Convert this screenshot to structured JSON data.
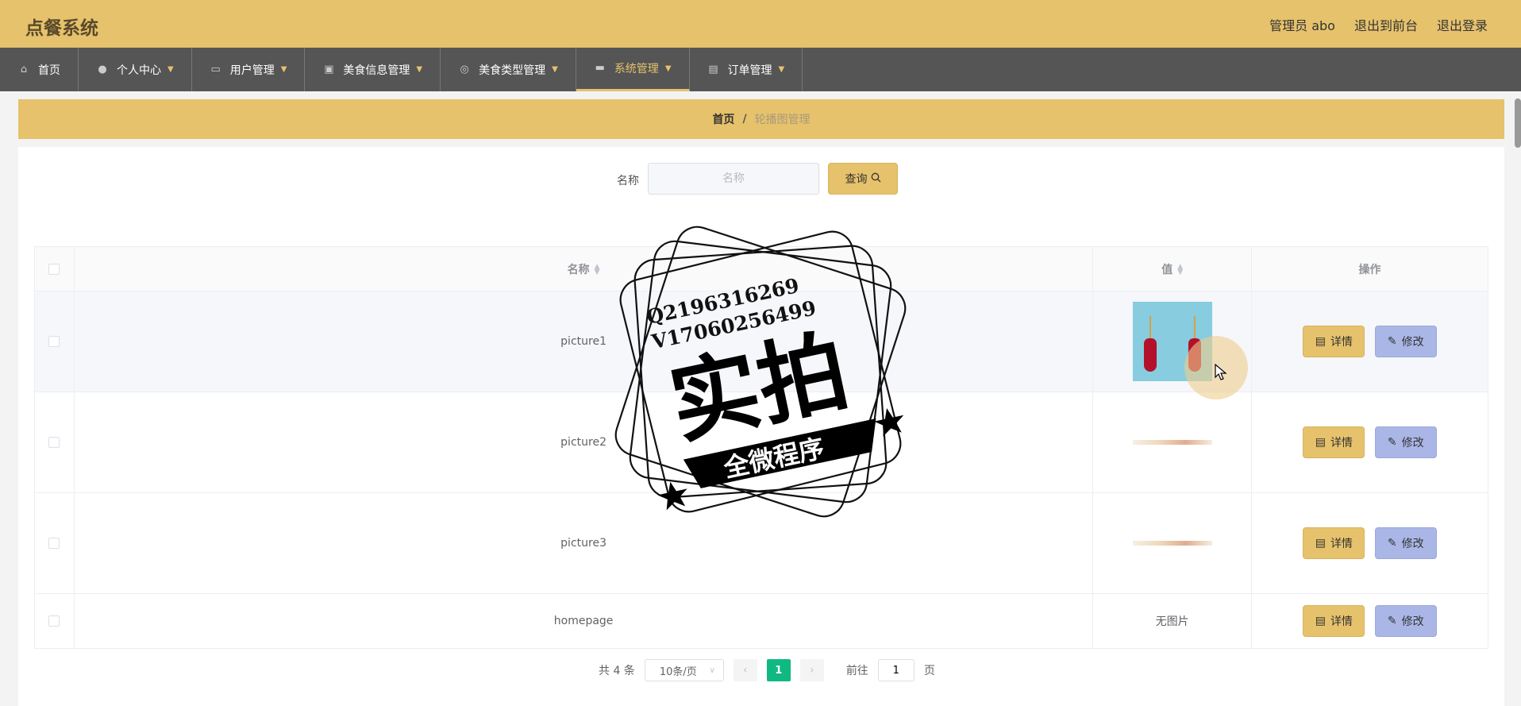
{
  "app": {
    "title": "点餐系统"
  },
  "top_links": {
    "user": "管理员 abo",
    "to_front": "退出到前台",
    "logout": "退出登录"
  },
  "nav": [
    {
      "label": "首页",
      "icon": "home-icon",
      "has_caret": false,
      "active": false
    },
    {
      "label": "个人中心",
      "icon": "user-icon",
      "has_caret": true,
      "active": false
    },
    {
      "label": "用户管理",
      "icon": "chat-icon",
      "has_caret": true,
      "active": false
    },
    {
      "label": "美食信息管理",
      "icon": "clipboard-icon",
      "has_caret": true,
      "active": false
    },
    {
      "label": "美食类型管理",
      "icon": "compass-icon",
      "has_caret": true,
      "active": false
    },
    {
      "label": "系统管理",
      "icon": "message-icon",
      "has_caret": true,
      "active": true
    },
    {
      "label": "订单管理",
      "icon": "document-icon",
      "has_caret": true,
      "active": false
    }
  ],
  "breadcrumb": {
    "home": "首页",
    "separator": "/",
    "current": "轮播图管理"
  },
  "search": {
    "label": "名称",
    "placeholder": "名称",
    "value": "",
    "button_label": "查询"
  },
  "table": {
    "headers": {
      "name": "名称",
      "value": "值",
      "actions": "操作"
    },
    "rows": [
      {
        "name": "picture1",
        "value_type": "image"
      },
      {
        "name": "picture2",
        "value_type": "image"
      },
      {
        "name": "picture3",
        "value_type": "image"
      },
      {
        "name": "homepage",
        "value_type": "text",
        "value_text": "无图片"
      }
    ],
    "detail_label": "详情",
    "edit_label": "修改"
  },
  "pagination": {
    "total_text": "共 4 条",
    "page_size": "10条/页",
    "current_page": "1",
    "goto_prefix": "前往",
    "goto_value": "1",
    "goto_suffix": "页"
  },
  "watermark": {
    "line1": "Q2196316269",
    "line2": "V17060256499",
    "big_text": "实拍",
    "ribbon": "全微程序"
  },
  "colors": {
    "accent": "#e6c26c",
    "nav_bg": "#555555",
    "edit_button": "#aab7e6",
    "page_active": "#10b981"
  }
}
